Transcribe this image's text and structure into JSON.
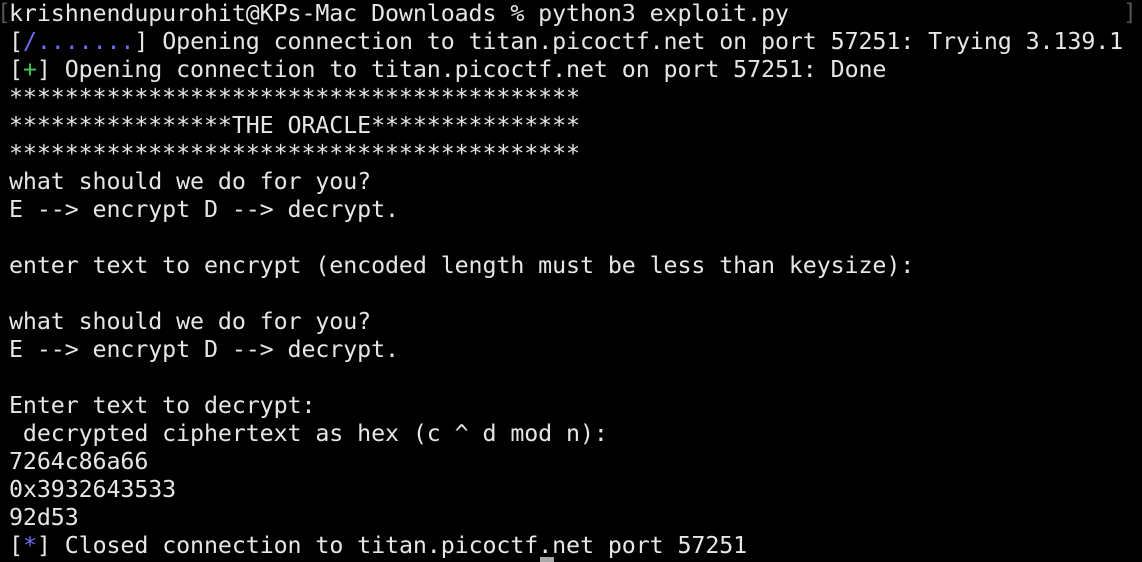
{
  "terminal": {
    "edge_left": "[",
    "edge_right": "]",
    "lines": [
      {
        "text": "krishnendupurohit@KPs-Mac Downloads % python3 exploit.py"
      },
      {
        "pre": "[",
        "mark": "/.......",
        "post": "] Opening connection to titan.picoctf.net on port 57251: Trying 3.139.1"
      },
      {
        "pre": "[",
        "mark": "+",
        "post": "] Opening connection to titan.picoctf.net on port 57251: Done"
      },
      {
        "text": "*****************************************"
      },
      {
        "text": "****************THE ORACLE***************"
      },
      {
        "text": "*****************************************"
      },
      {
        "text": "what should we do for you?"
      },
      {
        "text": "E --> encrypt D --> decrypt."
      },
      {
        "text": ""
      },
      {
        "text": "enter text to encrypt (encoded length must be less than keysize):"
      },
      {
        "text": ""
      },
      {
        "text": "what should we do for you?"
      },
      {
        "text": "E --> encrypt D --> decrypt."
      },
      {
        "text": ""
      },
      {
        "text": "Enter text to decrypt:"
      },
      {
        "text": " decrypted ciphertext as hex (c ^ d mod n):"
      },
      {
        "text": "7264c86a66"
      },
      {
        "text": "0x3932643533"
      },
      {
        "text": "92d53"
      },
      {
        "pre": "[",
        "mark": "*",
        "post": "] Closed connection to titan.picoctf.net port 57251"
      }
    ]
  },
  "colors": {
    "background": "#000000",
    "foreground": "#e6e6e6",
    "spinner": "#6f6cf2",
    "success": "#42c95a",
    "info": "#6f6cf2"
  }
}
